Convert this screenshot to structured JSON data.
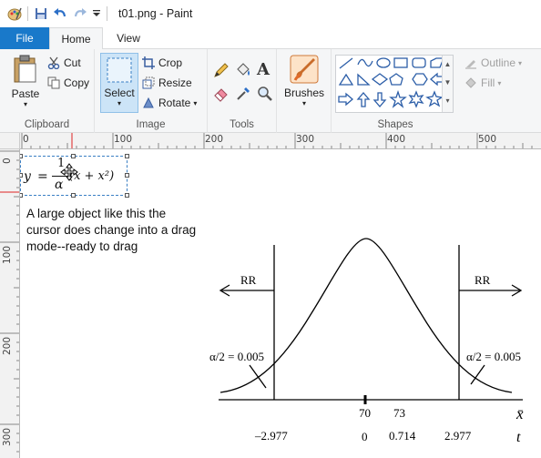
{
  "window": {
    "title": "t01.png - Paint"
  },
  "tabs": {
    "file": "File",
    "home": "Home",
    "view": "View"
  },
  "ribbon": {
    "clipboard": {
      "label": "Clipboard",
      "paste": "Paste",
      "cut": "Cut",
      "copy": "Copy"
    },
    "image": {
      "label": "Image",
      "select": "Select",
      "crop": "Crop",
      "resize": "Resize",
      "rotate": "Rotate"
    },
    "tools": {
      "label": "Tools"
    },
    "brushes": {
      "label": "Brushes"
    },
    "shapes": {
      "label": "Shapes",
      "outline": "Outline",
      "fill": "Fill"
    }
  },
  "ruler": {
    "top": [
      "0",
      "100",
      "200",
      "300",
      "400",
      "500"
    ],
    "left": [
      "0",
      "100",
      "200",
      "300"
    ]
  },
  "canvas": {
    "note": "A large object like this the cursor does change into a drag mode--ready to drag",
    "formula": {
      "y": "y",
      "eq": "=",
      "num": "1",
      "den": "α",
      "tail": "(x + x²)"
    },
    "graph": {
      "rr_left": "RR",
      "rr_right": "RR",
      "alpha_left": "α/2 = 0.005",
      "alpha_right": "α/2 = 0.005",
      "xbar_ticks": [
        "70",
        "73"
      ],
      "xbar_symbol": "x̄",
      "t_ticks": [
        "–2.977",
        "0",
        "0.714",
        "2.977"
      ],
      "t_symbol": "t"
    }
  },
  "colors": {
    "accent": "#1979ca",
    "ribbon_bg": "#f5f6f7",
    "selected": "#cce4f7"
  }
}
